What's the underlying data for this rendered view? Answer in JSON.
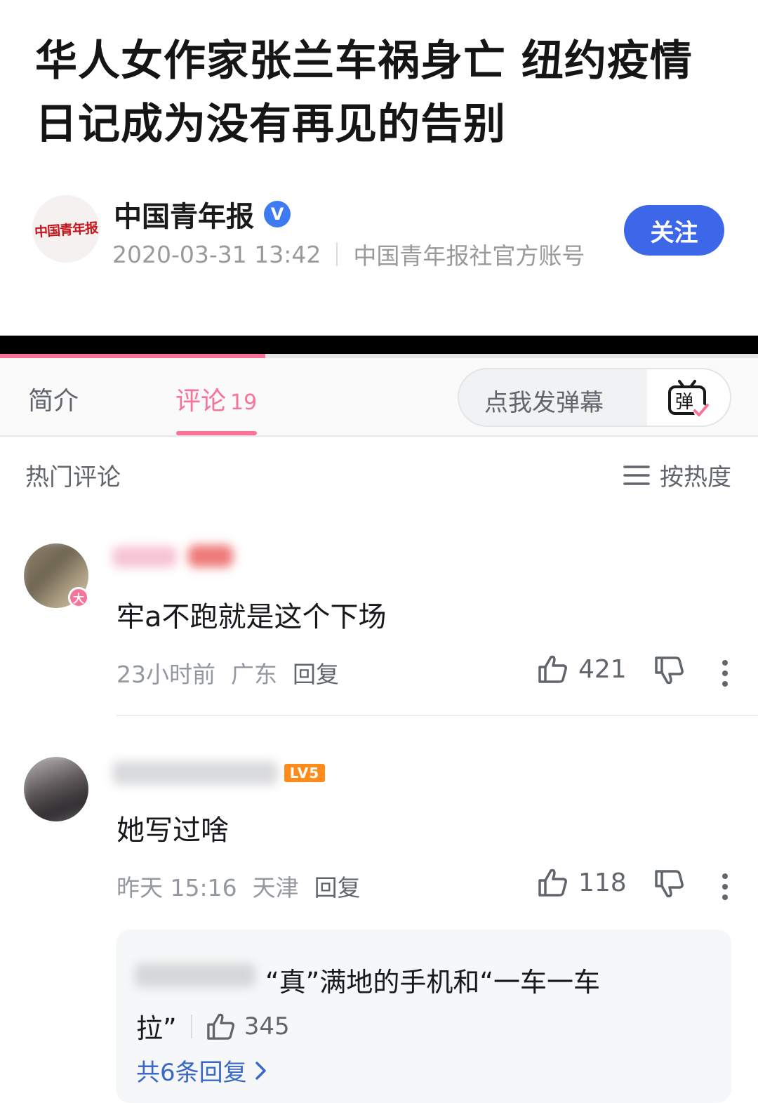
{
  "article": {
    "headline": "华人女作家张兰车祸身亡 纽约疫情日记成为没有再见的告别",
    "logo_text": "中国青年报",
    "source_name": "中国青年报",
    "verified_mark": "V",
    "datetime": "2020-03-31 13:42",
    "account_desc": "中国青年报社官方账号",
    "follow_label": "关注"
  },
  "video_progress": 0.35,
  "tabs": {
    "intro_label": "简介",
    "comments_label": "评论",
    "comments_count": "19",
    "danmaku_placeholder": "点我发弹幕",
    "danmaku_icon_char": "弹"
  },
  "list_header": {
    "title": "热门评论",
    "sort_label": "按热度"
  },
  "comments": [
    {
      "badge": "大",
      "text": "牢a不跑就是这个下场",
      "time": "23小时前",
      "location": "广东",
      "reply_label": "回复",
      "likes": "421"
    },
    {
      "level_badge": "LV5",
      "text": "她写过啥",
      "time": "昨天 15:16",
      "location": "天津",
      "reply_label": "回复",
      "likes": "118",
      "sub_reply": {
        "text_line1": "“真”满地的手机和“一车一车",
        "text_line2": "拉”",
        "likes": "345",
        "more_label": "共6条回复"
      }
    }
  ],
  "colors": {
    "accent_pink": "#fb7299",
    "follow_blue": "#3c67e8",
    "link_blue": "#3b68c6",
    "level_orange": "#ff8c1a"
  }
}
